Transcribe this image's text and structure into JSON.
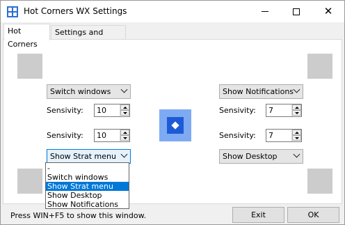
{
  "window": {
    "title": "Hot Corners WX Settings",
    "close_glyph": "✕"
  },
  "tabs": [
    {
      "label": "Hot Corners",
      "active": true
    },
    {
      "label": "Settings and About...",
      "active": false
    }
  ],
  "corners": {
    "top_left": {
      "action": "Switch windows",
      "sensitivity_label": "Sensivity:",
      "sensitivity": "10"
    },
    "top_right": {
      "action": "Show Notifications",
      "sensitivity_label": "Sensivity:",
      "sensitivity": "7"
    },
    "bottom_left": {
      "action": "Show Strat menu",
      "sensitivity_label": "Sensivity:",
      "sensitivity": "10"
    },
    "bottom_right": {
      "action": "Show Desktop",
      "sensitivity_label": "Sensivity:",
      "sensitivity": "7"
    }
  },
  "dropdown_open": {
    "options": [
      "-",
      "Switch windows",
      "Show Strat menu",
      "Show Desktop",
      "Show Notifications"
    ],
    "selected_index": 2
  },
  "status_text": "Press WIN+F5 to show this window.",
  "buttons": {
    "exit": "Exit",
    "ok": "OK"
  },
  "colors": {
    "accent": "#0078d7",
    "corner_box": "#cccccc",
    "center_icon_light": "#7eaaf3",
    "center_icon_dark": "#1d5bd6"
  }
}
